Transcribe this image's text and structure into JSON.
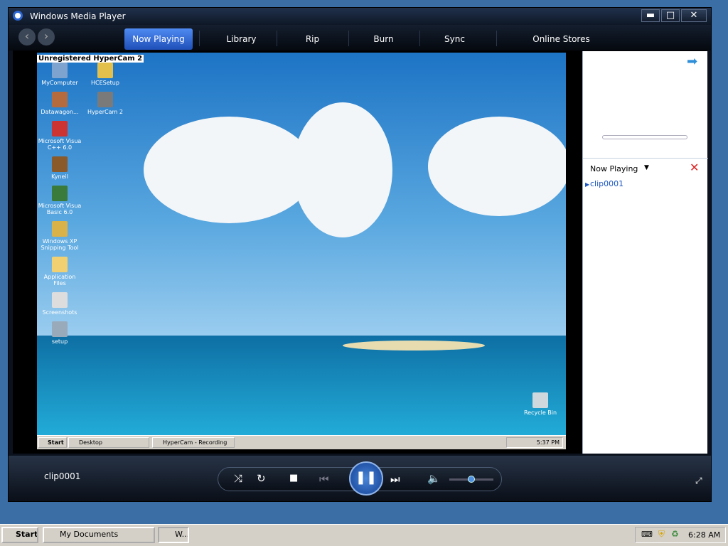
{
  "window": {
    "title": "Windows Media Player",
    "min": "▬",
    "max": "□",
    "close": "✕"
  },
  "nav": {
    "tabs": [
      "Now Playing",
      "Library",
      "Rip",
      "Burn",
      "Sync",
      "Online Stores"
    ]
  },
  "video": {
    "watermark": "Unregistered HyperCam 2",
    "icons": [
      {
        "label": "MyComputer",
        "color": "#7ea3cf"
      },
      {
        "label": "HCESetup",
        "color": "#e3c04b"
      },
      {
        "label": "Datawagon...",
        "color": "#b66b3e"
      },
      {
        "label": "HyperCam 2",
        "color": "#7a7a7a"
      },
      {
        "label": "Microsoft Visua C++ 6.0",
        "color": "#cc3333"
      },
      {
        "label": "Kyneil",
        "color": "#8a5a2b"
      },
      {
        "label": "Microsoft Visua Basic 6.0",
        "color": "#3a7a3a"
      },
      {
        "label": "Windows XP Snipping Tool",
        "color": "#d9b24a"
      },
      {
        "label": "Application Files",
        "color": "#f0d070"
      },
      {
        "label": "Screenshots",
        "color": "#dddddd"
      },
      {
        "label": "setup",
        "color": "#9ab"
      }
    ],
    "recycle": "Recycle Bin",
    "inner_taskbar": {
      "start": "Start",
      "items": [
        "Desktop",
        "HyperCam - Recording"
      ],
      "clock": "5:37 PM"
    }
  },
  "panel": {
    "title": "Now Playing",
    "items": [
      "clip0001"
    ]
  },
  "controls": {
    "track": "clip0001",
    "volume": 0.5
  },
  "taskbar": {
    "start": "Start",
    "buttons": [
      "My Documents",
      "W..."
    ],
    "clock": "6:28 AM"
  },
  "colors": {
    "accent": "#2b66d3",
    "link": "#1b55c0"
  }
}
